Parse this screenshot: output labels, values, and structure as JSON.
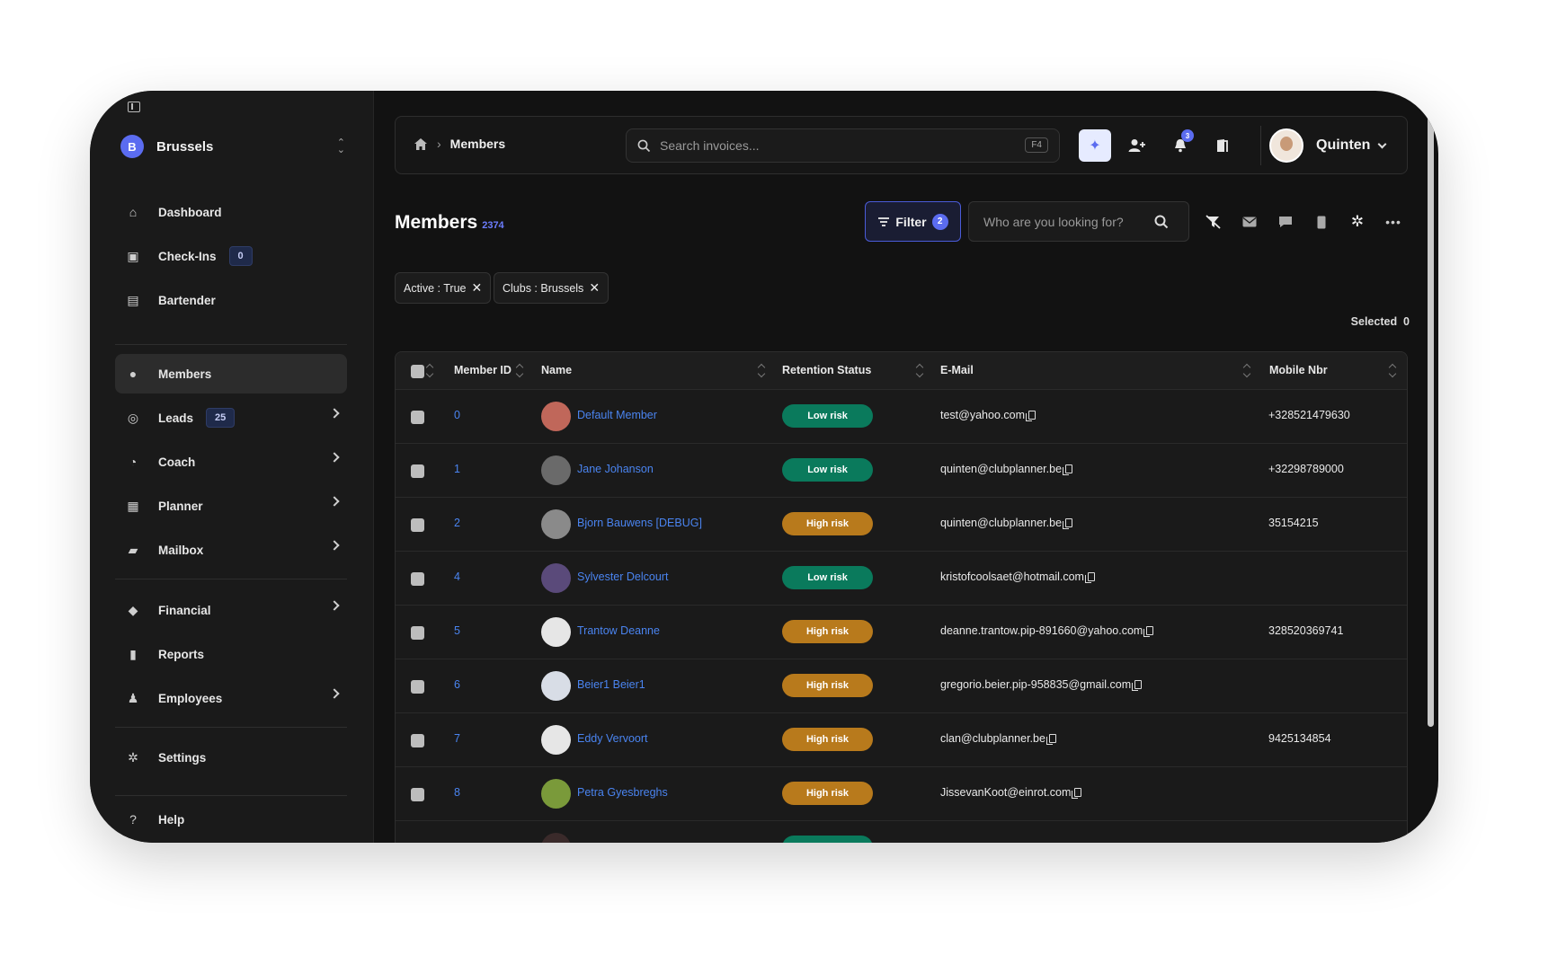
{
  "sidebar": {
    "club_name": "Brussels",
    "club_logo_letter": "B",
    "items": [
      {
        "label": "Dashboard",
        "icon": "home-icon",
        "glyph": "⌂"
      },
      {
        "label": "Check-Ins",
        "icon": "checkin-icon",
        "glyph": "▣",
        "badge": "0"
      },
      {
        "label": "Bartender",
        "icon": "bartender-icon",
        "glyph": "▤"
      },
      {
        "label": "Members",
        "icon": "members-icon",
        "glyph": "●",
        "active": true
      },
      {
        "label": "Leads",
        "icon": "target-icon",
        "glyph": "◎",
        "badge": "25"
      },
      {
        "label": "Coach",
        "icon": "fire-icon",
        "glyph": "◔"
      },
      {
        "label": "Planner",
        "icon": "calendar-icon",
        "glyph": "▦"
      },
      {
        "label": "Mailbox",
        "icon": "mailbox-icon",
        "glyph": "▰"
      },
      {
        "label": "Financial",
        "icon": "piggy-bank-icon",
        "glyph": "◆"
      },
      {
        "label": "Reports",
        "icon": "file-icon",
        "glyph": "▮"
      },
      {
        "label": "Employees",
        "icon": "user-icon",
        "glyph": "♟"
      },
      {
        "label": "Settings",
        "icon": "gear-icon",
        "glyph": "✲"
      },
      {
        "label": "Help",
        "icon": "help-icon",
        "glyph": "?"
      }
    ]
  },
  "topbar": {
    "breadcrumb_current": "Members",
    "search_placeholder": "Search invoices...",
    "search_shortcut": "F4",
    "notification_count": "3",
    "user_name": "Quinten"
  },
  "page": {
    "title": "Members",
    "count": "2374",
    "filter_label": "Filter",
    "filter_count": "2",
    "member_search_placeholder": "Who are you looking for?",
    "chips": [
      {
        "label": "Active : True"
      },
      {
        "label": "Clubs : Brussels"
      }
    ],
    "selected_label": "Selected",
    "selected_count": "0"
  },
  "table": {
    "columns": [
      "Member ID",
      "Name",
      "Retention Status",
      "E-Mail",
      "Mobile Nbr"
    ],
    "rows": [
      {
        "id": "0",
        "name": "Default Member",
        "status": "Low risk",
        "email": "test@yahoo.com",
        "mobile": "+328521479630",
        "avatar": "#c0675a"
      },
      {
        "id": "1",
        "name": "Jane Johanson",
        "status": "Low risk",
        "email": "quinten@clubplanner.be",
        "mobile": "+32298789000",
        "avatar": "#6a6a6a"
      },
      {
        "id": "2",
        "name": "Bjorn Bauwens [DEBUG]",
        "status": "High risk",
        "email": "quinten@clubplanner.be",
        "mobile": "35154215",
        "avatar": "#8a8a8a"
      },
      {
        "id": "4",
        "name": "Sylvester Delcourt",
        "status": "Low risk",
        "email": "kristofcoolsaet@hotmail.com",
        "mobile": "",
        "avatar": "#5a4a7a"
      },
      {
        "id": "5",
        "name": "Trantow Deanne",
        "status": "High risk",
        "email": "deanne.trantow.pip-891660@yahoo.com",
        "mobile": "328520369741",
        "avatar": "#e6e6e6"
      },
      {
        "id": "6",
        "name": "Beier1 Beier1",
        "status": "High risk",
        "email": "gregorio.beier.pip-958835@gmail.com",
        "mobile": "",
        "avatar": "#d8dde6"
      },
      {
        "id": "7",
        "name": "Eddy Vervoort",
        "status": "High risk",
        "email": "clan@clubplanner.be",
        "mobile": "9425134854",
        "avatar": "#e6e6e6"
      },
      {
        "id": "8",
        "name": "Petra Gyesbreghs",
        "status": "High risk",
        "email": "JissevanKoot@einrot.com",
        "mobile": "",
        "avatar": "#7a9a3a"
      },
      {
        "id": "",
        "name": "",
        "status": "Low risk",
        "email": "",
        "mobile": "",
        "avatar": "#3a2a2a"
      }
    ]
  },
  "colors": {
    "low_risk": "#0a7a5c",
    "high_risk": "#b87a1c",
    "accent": "#5b6cf0",
    "link": "#4a84f0"
  }
}
